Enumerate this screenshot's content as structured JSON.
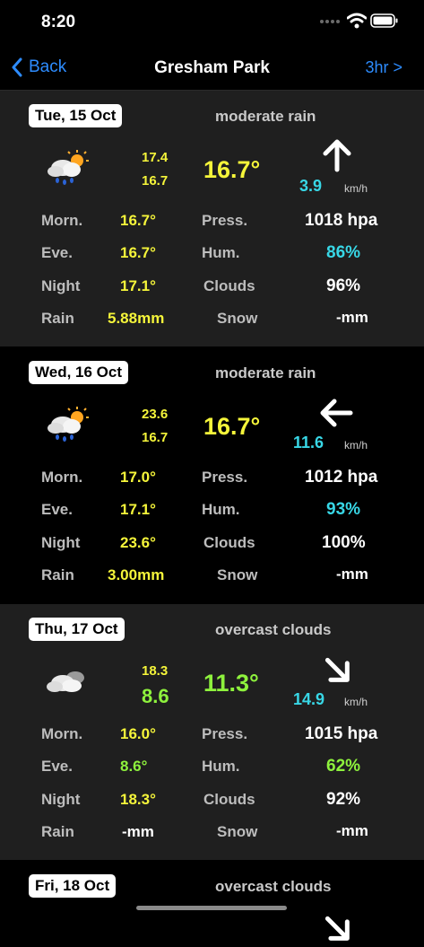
{
  "status": {
    "time": "8:20"
  },
  "nav": {
    "back_label": "Back",
    "title": "Gresham Park",
    "right_label": "3hr >"
  },
  "labels": {
    "morn": "Morn.",
    "eve": "Eve.",
    "night": "Night",
    "rain": "Rain",
    "press": "Press.",
    "hum": "Hum.",
    "clouds": "Clouds",
    "snow": "Snow",
    "wind_unit": "km/h"
  },
  "days": [
    {
      "date": "Tue, 15 Oct",
      "description": "moderate rain",
      "icon": "rain-sun-icon",
      "hi": "17.4",
      "lo": "16.7",
      "temp": "16.7°",
      "wind_dir": "north",
      "wind_speed": "3.9",
      "morn": "16.7°",
      "eve": "16.7°",
      "night": "17.1°",
      "rain": "5.88mm",
      "pressure": "1018 hpa",
      "humidity": "86%",
      "clouds": "96%",
      "snow": "-mm"
    },
    {
      "date": "Wed, 16 Oct",
      "description": "moderate rain",
      "icon": "rain-sun-icon",
      "hi": "23.6",
      "lo": "16.7",
      "temp": "16.7°",
      "wind_dir": "west",
      "wind_speed": "11.6",
      "morn": "17.0°",
      "eve": "17.1°",
      "night": "23.6°",
      "rain": "3.00mm",
      "pressure": "1012 hpa",
      "humidity": "93%",
      "clouds": "100%",
      "snow": "-mm"
    },
    {
      "date": "Thu, 17 Oct",
      "description": "overcast clouds",
      "icon": "cloud-icon",
      "hi": "18.3",
      "lo": "8.6",
      "temp": "11.3°",
      "wind_dir": "southeast",
      "wind_speed": "14.9",
      "morn": "16.0°",
      "eve": "8.6°",
      "night": "18.3°",
      "rain": "-mm",
      "pressure": "1015 hpa",
      "humidity": "62%",
      "clouds": "92%",
      "snow": "-mm"
    },
    {
      "date": "Fri, 18 Oct",
      "description": "overcast clouds"
    }
  ],
  "colors": {
    "accent": "#2d8cff",
    "yellow": "#f5f53a",
    "green": "#8ef23d",
    "cyan": "#38d7e6"
  }
}
